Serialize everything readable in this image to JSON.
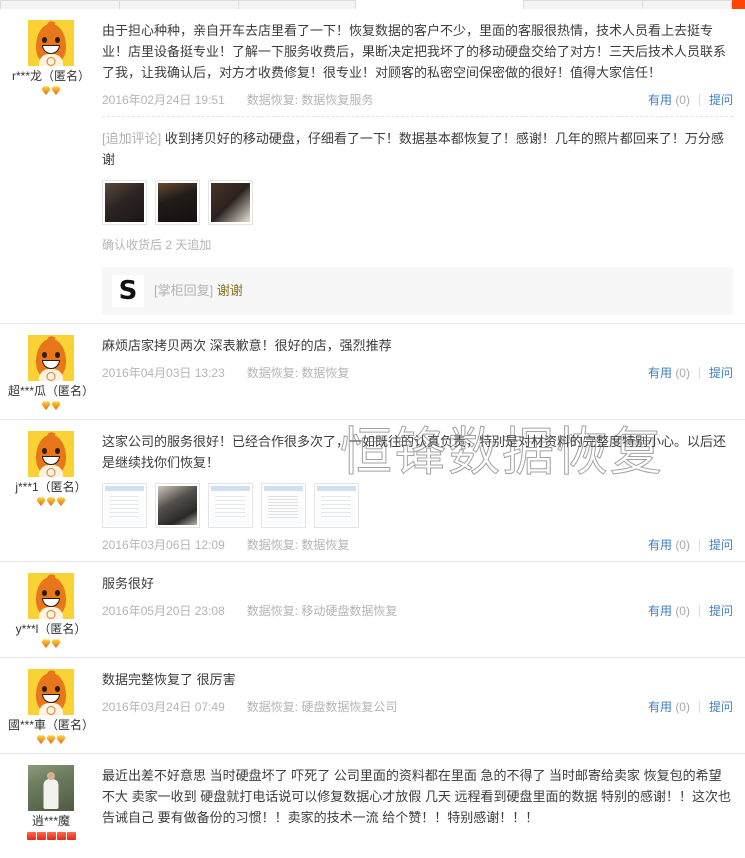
{
  "tabs": {
    "items": [
      {
        "label": "",
        "active": false
      },
      {
        "label": "",
        "active": false
      },
      {
        "label": "",
        "active": false
      },
      {
        "label": "",
        "active": false
      },
      {
        "label": "",
        "active": false
      }
    ],
    "active_color": "#ff4400"
  },
  "watermark": "恒锋数据恢复",
  "labels": {
    "useful": "有用",
    "ask": "提问",
    "append_tag": "[追加评论]",
    "seller_reply_tag": "[掌柜回复]",
    "anonymous_suffix": "（匿名）"
  },
  "reviews": [
    {
      "user": "r***龙（匿名）",
      "avatar": "taobao-default-avatar",
      "rank_count": 2,
      "rank_type": "gem",
      "text": "由于担心种种，亲自开车去店里看了一下！恢复数据的客户不少，里面的客服很热情，技术人员看上去挺专业！店里设备挺专业！了解一下服务收费后，果断决定把我坏了的移动硬盘交给了对方！三天后技术人员联系了我，让我确认后，对方才收费修复！很专业！对顾客的私密空间保密做的很好！值得大家信任！",
      "date": "2016年02月24日 19:51",
      "category": "数据恢复: 数据恢复服务",
      "useful_count": "(0)",
      "append": {
        "tag": "[追加评论]",
        "text": "收到拷贝好的移动硬盘，仔细看了一下！数据基本都恢复了！感谢！几年的照片都回来了！万分感谢",
        "thumbs": [
          "hdd1",
          "hdd2",
          "hdd3"
        ],
        "note": "确认收货后 2 天追加"
      },
      "seller_reply": {
        "logo": "S",
        "tag": "[掌柜回复]",
        "body": "谢谢"
      }
    },
    {
      "user": "超***瓜（匿名）",
      "avatar": "taobao-default-avatar",
      "rank_count": 2,
      "rank_type": "gem",
      "text": "麻烦店家拷贝两次 深表歉意！很好的店，强烈推荐",
      "date": "2016年04月03日 13:23",
      "category": "数据恢复: 数据恢复",
      "useful_count": "(0)"
    },
    {
      "user": "j***1（匿名）",
      "avatar": "taobao-default-avatar",
      "rank_count": 3,
      "rank_type": "gem",
      "text": "这家公司的服务很好！已经合作很多次了，一如既往的认真负责，特别是对材资料的完整度特别小心。以后还是继续找你们恢复！",
      "date": "2016年03月06日 12:09",
      "category": "数据恢复: 数据恢复",
      "useful_count": "(0)",
      "thumbs": [
        "win",
        "photo2",
        "win",
        "win2",
        "win"
      ]
    },
    {
      "user": "y***l（匿名）",
      "avatar": "taobao-default-avatar",
      "rank_count": 2,
      "rank_type": "gem",
      "text": "服务很好",
      "date": "2016年05月20日 23:08",
      "category": "数据恢复: 移动硬盘数据恢复",
      "useful_count": "(0)"
    },
    {
      "user": "國***車（匿名）",
      "avatar": "taobao-default-avatar",
      "rank_count": 3,
      "rank_type": "gem",
      "text": "数据完整恢复了 很厉害",
      "date": "2016年03月24日 07:49",
      "category": "数据恢复: 硬盘数据恢复公司",
      "useful_count": "(0)"
    },
    {
      "user": "逍***魔",
      "avatar": "photo-avatar",
      "rank_count": 5,
      "rank_type": "heart",
      "text": "最近出差不好意思 当时硬盘坏了 吓死了 公司里面的资料都在里面 急的不得了 当时邮寄给卖家 恢复包的希望不大 卖家一收到 硬盘就打电话说可以修复数据心才放假 几天 远程看到硬盘里面的数据 特别的感谢！！这次也告诫自己 要有做备份的习惯！！卖家的技术一流 给个赞！！特别感谢！！！"
    }
  ]
}
